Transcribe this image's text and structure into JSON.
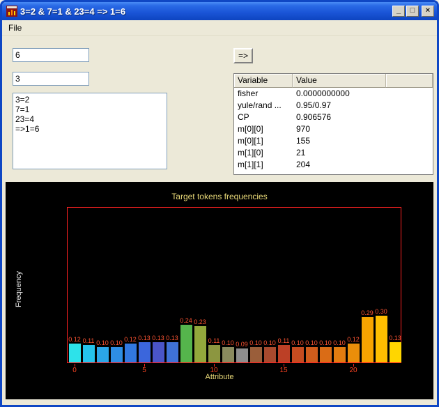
{
  "window": {
    "title": "3=2 & 7=1 & 23=4 => 1=6",
    "controls": {
      "minimize_glyph": "_",
      "maximize_glyph": "□",
      "close_glyph": "×"
    }
  },
  "menu": {
    "file_label": "File"
  },
  "form": {
    "input1_value": "6",
    "input2_value": "3",
    "rules_value": "3=2\n7=1\n23=4\n=>1=6",
    "run_button_label": "=>"
  },
  "table": {
    "headers": [
      "Variable",
      "Value",
      ""
    ],
    "rows": [
      {
        "variable": "fisher",
        "value": "0.0000000000"
      },
      {
        "variable": "yule/rand ...",
        "value": "0.95/0.97"
      },
      {
        "variable": "CP",
        "value": "0.906576"
      },
      {
        "variable": "m[0][0]",
        "value": "970"
      },
      {
        "variable": "m[0][1]",
        "value": "155"
      },
      {
        "variable": "m[1][0]",
        "value": "21"
      },
      {
        "variable": "m[1][1]",
        "value": "204"
      }
    ]
  },
  "chart_data": {
    "type": "bar",
    "title": "Target tokens frequencies",
    "xlabel": "Attribute",
    "ylabel": "Frequency",
    "x": [
      0,
      1,
      2,
      3,
      4,
      5,
      6,
      7,
      8,
      9,
      10,
      11,
      12,
      13,
      14,
      15,
      16,
      17,
      18,
      19,
      20,
      21,
      22,
      23
    ],
    "values": [
      0.12,
      0.11,
      0.1,
      0.1,
      0.12,
      0.13,
      0.13,
      0.13,
      0.24,
      0.23,
      0.11,
      0.1,
      0.09,
      0.1,
      0.1,
      0.11,
      0.1,
      0.1,
      0.1,
      0.1,
      0.12,
      0.29,
      0.3,
      0.13
    ],
    "bar_colors": [
      "#2de2ea",
      "#25c3ec",
      "#2ba6e8",
      "#2e8ee4",
      "#3278e0",
      "#3b66dc",
      "#4a55c8",
      "#3f72d8",
      "#55b44c",
      "#93a83c",
      "#8c9640",
      "#8a8a5e",
      "#8e8e8e",
      "#9a5e3a",
      "#a84a2e",
      "#bc4026",
      "#c64c20",
      "#d05c1c",
      "#da6c16",
      "#e27c10",
      "#ea8e0a",
      "#f8a400",
      "#ffbe00",
      "#ffd600"
    ],
    "x_ticks": [
      0,
      5,
      10,
      15,
      20
    ],
    "ylim": [
      0,
      1.0
    ],
    "grid": false,
    "legend": false,
    "colors": {
      "background": "#000000",
      "plot_border": "#ff2222",
      "title": "#e8d878",
      "xlabel": "#e8d878",
      "ylabel": "#ededed",
      "tick_labels": "#ff4422",
      "bar_value_labels": "#ff5533"
    }
  }
}
